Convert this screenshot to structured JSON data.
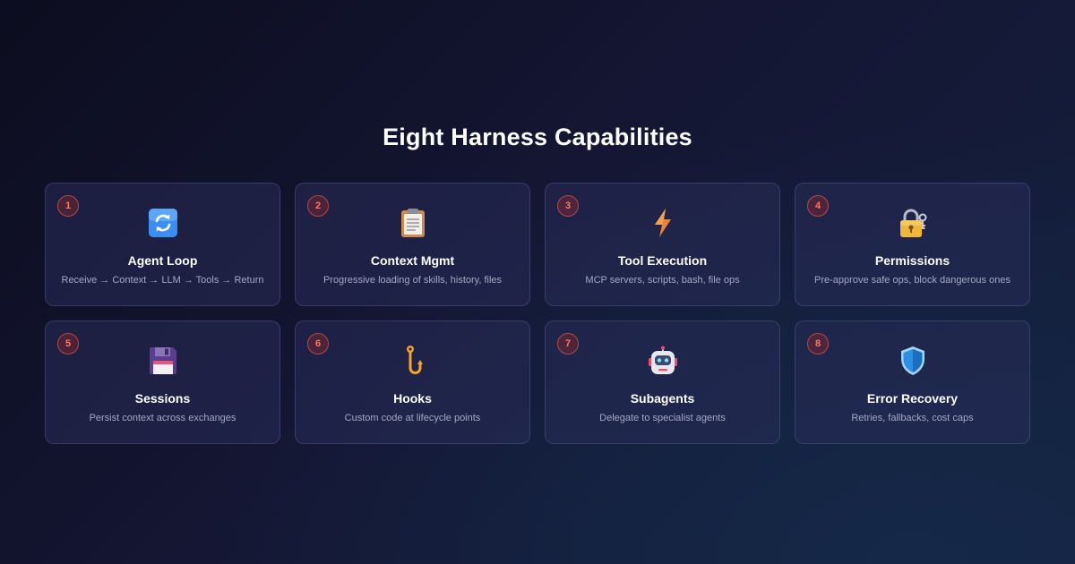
{
  "title": "Eight Harness Capabilities",
  "cards": [
    {
      "number": "1",
      "icon": "refresh-icon",
      "title": "Agent Loop",
      "description": "Receive → Context → LLM → Tools → Return"
    },
    {
      "number": "2",
      "icon": "clipboard-icon",
      "title": "Context Mgmt",
      "description": "Progressive loading of skills, history, files"
    },
    {
      "number": "3",
      "icon": "lightning-icon",
      "title": "Tool Execution",
      "description": "MCP servers, scripts, bash, file ops"
    },
    {
      "number": "4",
      "icon": "lock-with-key-icon",
      "title": "Permissions",
      "description": "Pre-approve safe ops, block dangerous ones"
    },
    {
      "number": "5",
      "icon": "floppy-disk-icon",
      "title": "Sessions",
      "description": "Persist context across exchanges"
    },
    {
      "number": "6",
      "icon": "hook-icon",
      "title": "Hooks",
      "description": "Custom code at lifecycle points"
    },
    {
      "number": "7",
      "icon": "robot-icon",
      "title": "Subagents",
      "description": "Delegate to specialist agents"
    },
    {
      "number": "8",
      "icon": "shield-icon",
      "title": "Error Recovery",
      "description": "Retries, fallbacks, cost caps"
    }
  ],
  "colors": {
    "background": "#111429",
    "card_background": "#262a52",
    "badge_text": "#ff7a5c",
    "badge_border": "#b04a45",
    "description_text": "#a3a8c6"
  }
}
